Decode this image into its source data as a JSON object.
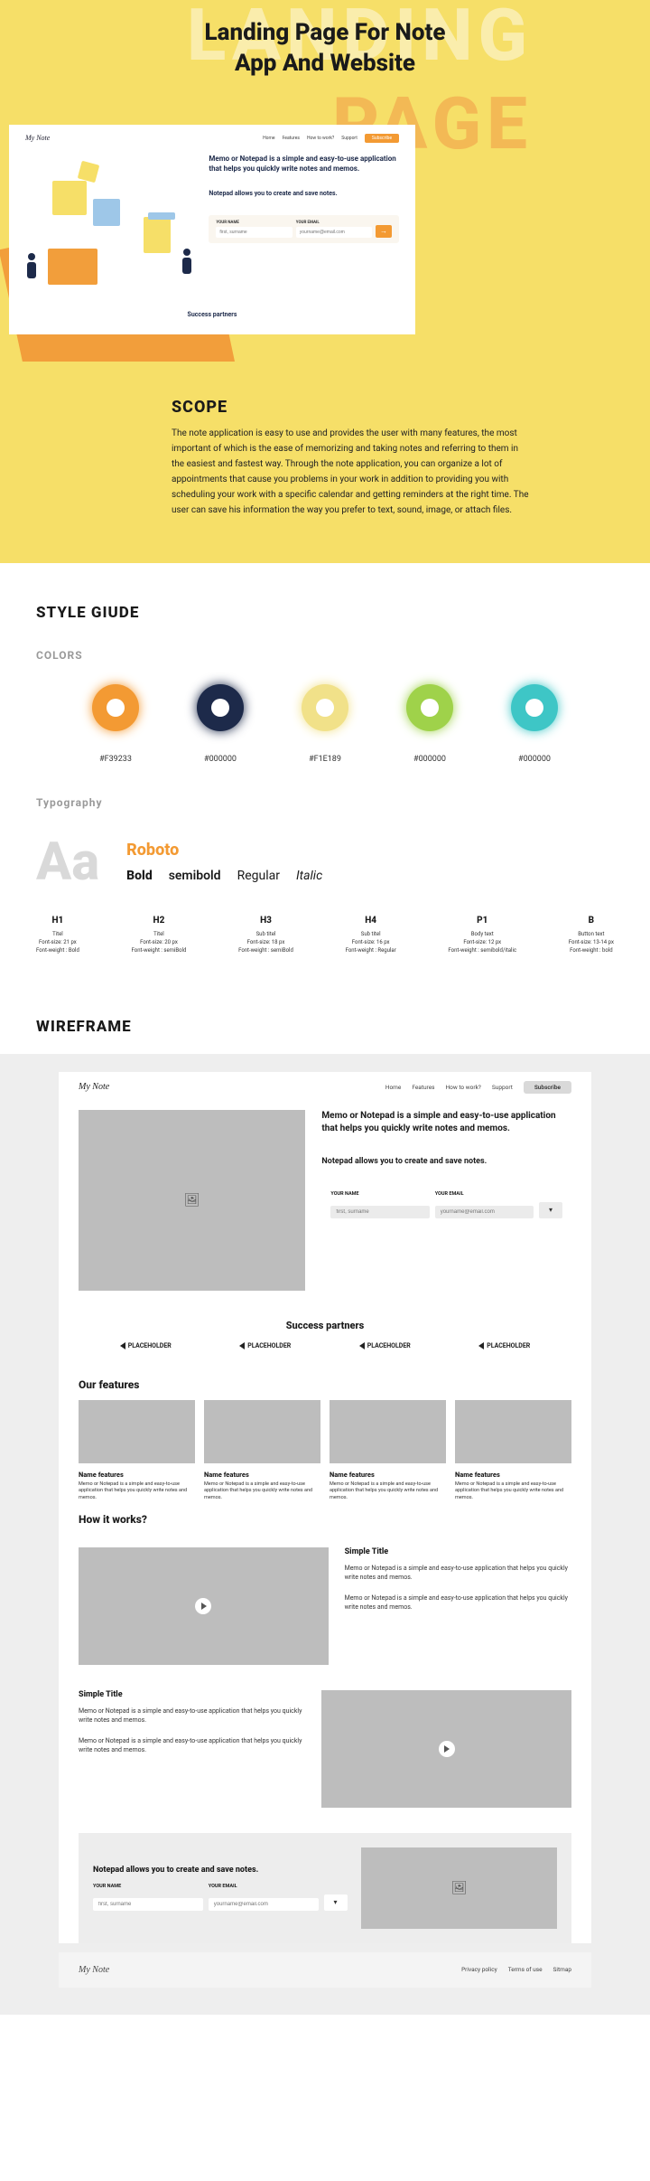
{
  "hero": {
    "title_line1": "Landing Page For Note",
    "title_line2": "App And Website",
    "bgword1": "LANDING",
    "bgword2": "PAGE"
  },
  "mockup": {
    "logo": "My Note",
    "nav": [
      "Home",
      "Features",
      "How to work?",
      "Support"
    ],
    "subscribe": "Subscribe",
    "headline": "Memo or Notepad is a simple and easy-to-use application that helps you quickly write notes and memos.",
    "subline": "Notepad allows you to create and save notes.",
    "form": {
      "name_label": "YOUR NAME",
      "name_placeholder": "first, surname",
      "email_label": "YOUR EMAIL",
      "email_placeholder": "yourname@email.com",
      "go": "→"
    },
    "partners": "Success partners"
  },
  "scope": {
    "title": "SCOPE",
    "body": "The note application is easy to use and provides the user with many features, the most important of which is the ease of memorizing and taking notes and referring to them in the easiest and fastest way. Through the note application, you can organize a lot of appointments that cause you problems in your work in addition to providing you with scheduling your work with a specific calendar and getting reminders at the right time. The user can save his information the way you prefer to text, sound, image, or attach files."
  },
  "style_guide": {
    "title": "STYLE GIUDE",
    "colors_title": "COLORS",
    "swatches": [
      "#F39233",
      "#000000",
      "#F1E189",
      "#000000",
      "#000000"
    ],
    "typo_title": "Typography",
    "Aa": "Aa",
    "font_name": "Roboto",
    "weights": [
      "Bold",
      "semibold",
      "Regular",
      "Italic"
    ],
    "type_specs": [
      {
        "h": "H1",
        "l1": "Titel",
        "l2": "Font-size: 21 px",
        "l3": "Font-weight : Bold"
      },
      {
        "h": "H2",
        "l1": "Titel",
        "l2": "Font-size: 20 px",
        "l3": "Font-weight : semiBold"
      },
      {
        "h": "H3",
        "l1": "Sub titel",
        "l2": "Font-size: 18 px",
        "l3": "Font-weight : semiBold"
      },
      {
        "h": "H4",
        "l1": "Sub titel",
        "l2": "Font-size: 16 px",
        "l3": "Font-weight : Regular"
      },
      {
        "h": "P1",
        "l1": "Body text",
        "l2": "Font-size: 12 px",
        "l3": "Font-weight : semibold/italic"
      },
      {
        "h": "B",
        "l1": "Button text",
        "l2": "Font-size: 13-14 px",
        "l3": "Font-weight : bold"
      }
    ]
  },
  "wireframe": {
    "title": "WIREFRAME",
    "logo": "My Note",
    "nav": [
      "Home",
      "Features",
      "How to work?",
      "Support"
    ],
    "subscribe": "Subscribe",
    "headline": "Memo or Notepad is a simple and easy-to-use application that helps you quickly write notes and memos.",
    "subline": "Notepad allows you to create and save notes.",
    "form": {
      "name_label": "YOUR NAME",
      "name_placeholder": "first, surname",
      "email_label": "YOUR EMAIL",
      "email_placeholder": "yourname@email.com",
      "dd": "▾"
    },
    "partners_title": "Success partners",
    "placeholder_label": "PLACEHOLDER",
    "features_title": "Our features",
    "feature": {
      "name": "Name features",
      "desc": "Memo or Notepad is a simple and easy-to-use application that helps you quickly write notes and memos."
    },
    "how_title": "How it works?",
    "how_item_title": "Simple Title",
    "how_item_body": "Memo or Notepad is a simple and easy-to-use application that helps you quickly write notes and memos.",
    "cta_title": "Notepad allows you to create and save notes.",
    "footer_links": [
      "Privacy policy",
      "Terms of use",
      "Sitmap"
    ]
  }
}
